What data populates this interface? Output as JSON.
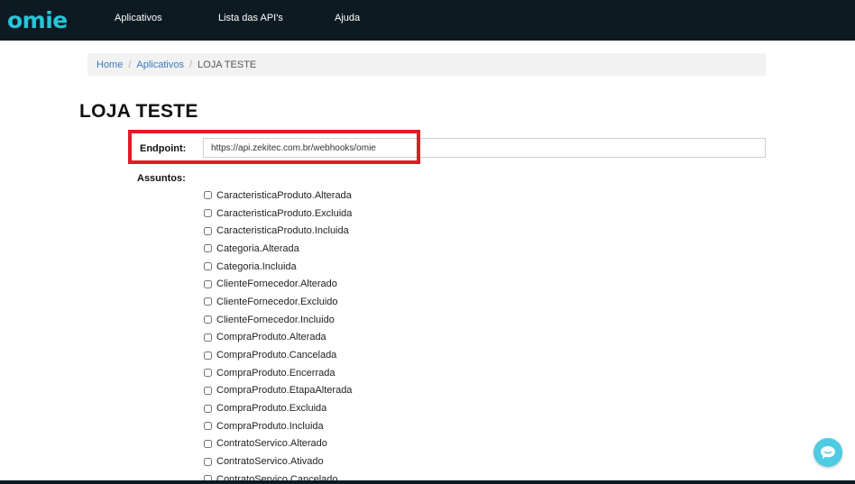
{
  "navbar": {
    "logo": "omie",
    "items": [
      {
        "label": "Aplicativos"
      },
      {
        "label": "Lista das API's"
      },
      {
        "label": "Ajuda"
      }
    ]
  },
  "breadcrumb": {
    "home": "Home",
    "section": "Aplicativos",
    "current": "LOJA TESTE"
  },
  "page": {
    "title": "LOJA TESTE"
  },
  "form": {
    "endpoint_label": "Endpoint:",
    "endpoint_value": "https://api.zekitec.com.br/webhooks/omie",
    "assuntos_label": "Assuntos:",
    "subjects": [
      "CaracteristicaProduto.Alterada",
      "CaracteristicaProduto.Excluida",
      "CaracteristicaProduto.Incluida",
      "Categoria.Alterada",
      "Categoria.Incluida",
      "ClienteFornecedor.Alterado",
      "ClienteFornecedor.Excluido",
      "ClienteFornecedor.Incluido",
      "CompraProduto.Alterada",
      "CompraProduto.Cancelada",
      "CompraProduto.Encerrada",
      "CompraProduto.EtapaAlterada",
      "CompraProduto.Excluida",
      "CompraProduto.Incluida",
      "ContratoServico.Alterado",
      "ContratoServico.Ativado",
      "ContratoServico.Cancelado"
    ]
  },
  "colors": {
    "navbar_bg": "#0e1a22",
    "logo": "#27c5d8",
    "link": "#3a7bbf",
    "highlight": "#e01b24",
    "chat": "#4ecbe0"
  },
  "icons": {
    "chat": "chat-bubble-icon"
  }
}
